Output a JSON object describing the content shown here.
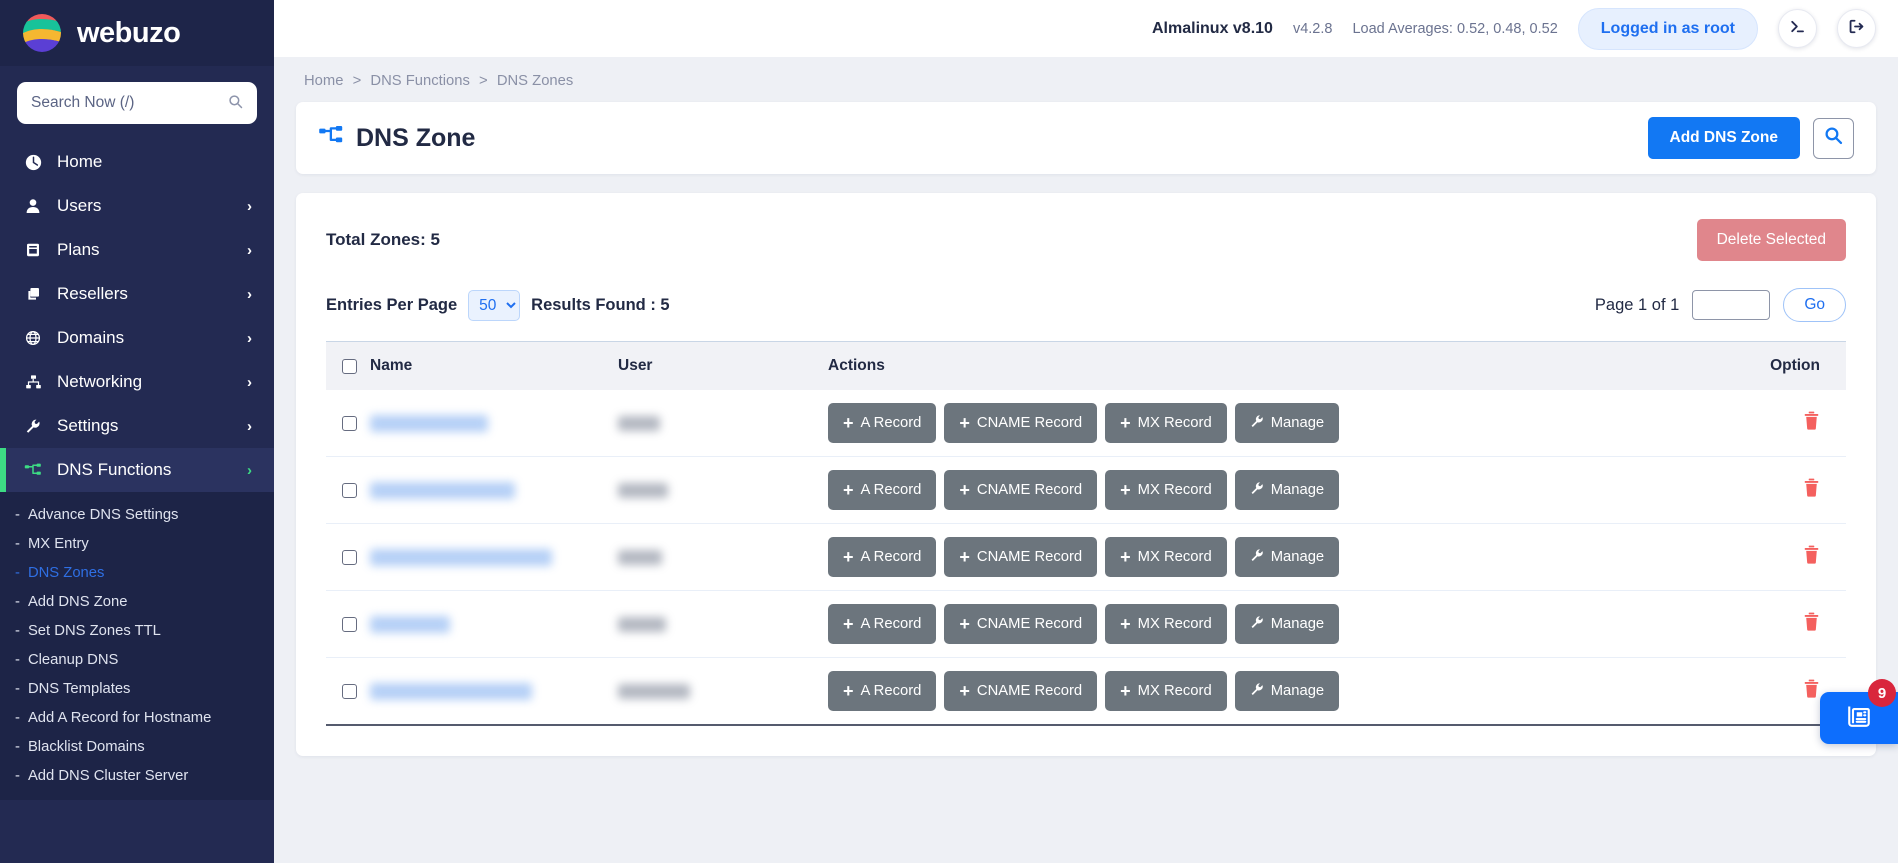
{
  "brand": {
    "name": "webuzo",
    "logo_icon": "webuzo-globe-logo"
  },
  "sidebar": {
    "search": {
      "placeholder": "Search Now (/)",
      "value": "",
      "icon": "search-icon"
    },
    "items": [
      {
        "label": "Home",
        "icon": "dashboard-icon",
        "expandable": false
      },
      {
        "label": "Users",
        "icon": "user-icon",
        "expandable": true
      },
      {
        "label": "Plans",
        "icon": "book-icon",
        "expandable": true
      },
      {
        "label": "Resellers",
        "icon": "windows-icon",
        "expandable": true
      },
      {
        "label": "Domains",
        "icon": "globe-icon",
        "expandable": true
      },
      {
        "label": "Networking",
        "icon": "sitemap-icon",
        "expandable": true
      },
      {
        "label": "Settings",
        "icon": "wrench-icon",
        "expandable": true
      },
      {
        "label": "DNS Functions",
        "icon": "dns-icon",
        "expandable": true,
        "active": true
      }
    ],
    "submenu": [
      {
        "label": "Advance DNS Settings"
      },
      {
        "label": "MX Entry"
      },
      {
        "label": "DNS Zones",
        "active": true
      },
      {
        "label": "Add DNS Zone"
      },
      {
        "label": "Set DNS Zones TTL"
      },
      {
        "label": "Cleanup DNS"
      },
      {
        "label": "DNS Templates"
      },
      {
        "label": "Add A Record for Hostname"
      },
      {
        "label": "Blacklist Domains"
      },
      {
        "label": "Add DNS Cluster Server"
      }
    ],
    "collapse_icon": "chevron-left-icon"
  },
  "topbar": {
    "os": "Almalinux v8.10",
    "version": "v4.2.8",
    "load_averages": "Load Averages: 0.52, 0.48, 0.52",
    "login_pill": "Logged in as root",
    "terminal_icon": "terminal-icon",
    "logout_icon": "logout-icon"
  },
  "breadcrumb": {
    "items": [
      "Home",
      "DNS Functions",
      "DNS Zones"
    ],
    "separator": ">"
  },
  "page": {
    "title": "DNS Zone",
    "title_icon": "dns-sitemap-icon",
    "add_button": "Add DNS Zone",
    "search_icon": "search-icon"
  },
  "panel": {
    "total_zones_label": "Total Zones: 5",
    "delete_selected": "Delete Selected",
    "entries_per_page_label": "Entries Per Page",
    "entries_per_page_value": "50",
    "entries_per_page_options": [
      "50"
    ],
    "results_found": "Results Found : 5",
    "page_of": "Page 1 of 1",
    "page_input_value": "",
    "go_button": "Go"
  },
  "table": {
    "columns": [
      "Name",
      "User",
      "Actions",
      "Option"
    ],
    "action_buttons": [
      {
        "label": "A Record",
        "icon": "plus-icon"
      },
      {
        "label": "CNAME Record",
        "icon": "plus-icon"
      },
      {
        "label": "MX Record",
        "icon": "plus-icon"
      },
      {
        "label": "Manage",
        "icon": "wrench-icon"
      }
    ],
    "delete_icon": "trash-icon",
    "rows": [
      {
        "name": "",
        "user": "",
        "name_width": 118,
        "user_width": 42
      },
      {
        "name": "",
        "user": "",
        "name_width": 145,
        "user_width": 50
      },
      {
        "name": "",
        "user": "",
        "name_width": 182,
        "user_width": 44
      },
      {
        "name": "",
        "user": "",
        "name_width": 80,
        "user_width": 48
      },
      {
        "name": "",
        "user": "",
        "name_width": 162,
        "user_width": 72
      }
    ]
  },
  "float_widget": {
    "icon": "news-document-icon",
    "badge": "9"
  },
  "colors": {
    "sidebar_bg": "#232a52",
    "submenu_bg": "#1d2447",
    "accent_green": "#3ddc84",
    "primary_blue": "#1278f3",
    "link_blue": "#2f6fe4",
    "danger_soft": "#e0868c",
    "action_gray": "#6c757d",
    "trash_red": "#f4605e",
    "badge_red": "#d9263c"
  }
}
